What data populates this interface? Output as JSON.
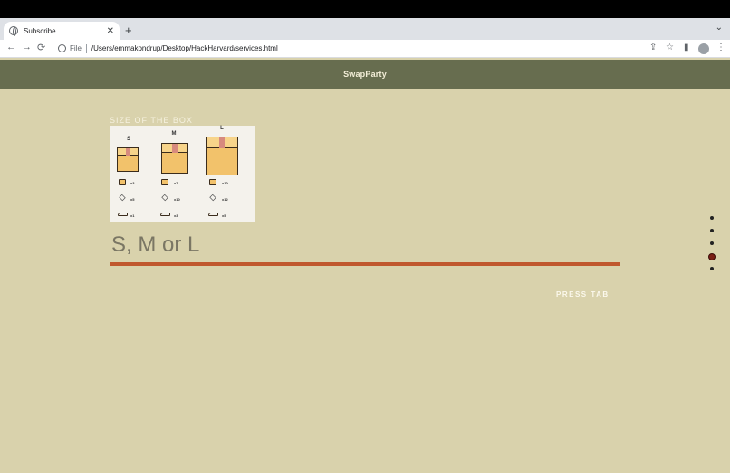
{
  "browser": {
    "tab_title": "Subscribe",
    "tab_close": "✕",
    "new_tab": "+",
    "tab_menu": "⌄",
    "back": "←",
    "forward": "→",
    "reload": "⟳",
    "info": "i",
    "scheme_label": "File",
    "url": "/Users/emmakondrup/Desktop/HackHarvard/services.html",
    "share": "⇪",
    "star": "☆",
    "sidepanel": "▮",
    "menu": "⋮"
  },
  "header": {
    "brand": "SwapParty"
  },
  "content": {
    "size_label": "SIZE OF THE BOX",
    "input_placeholder": "S, M or L",
    "press_tab": "PRESS TAB"
  },
  "boxes": [
    {
      "size": "S",
      "shirts": "x3",
      "gems": "x5",
      "shoes": "x1"
    },
    {
      "size": "M",
      "shirts": "x7",
      "gems": "x10",
      "shoes": "x3"
    },
    {
      "size": "L",
      "shirts": "x10",
      "gems": "x12",
      "shoes": "x5"
    }
  ],
  "pager": {
    "count": 5,
    "active_index": 3
  }
}
